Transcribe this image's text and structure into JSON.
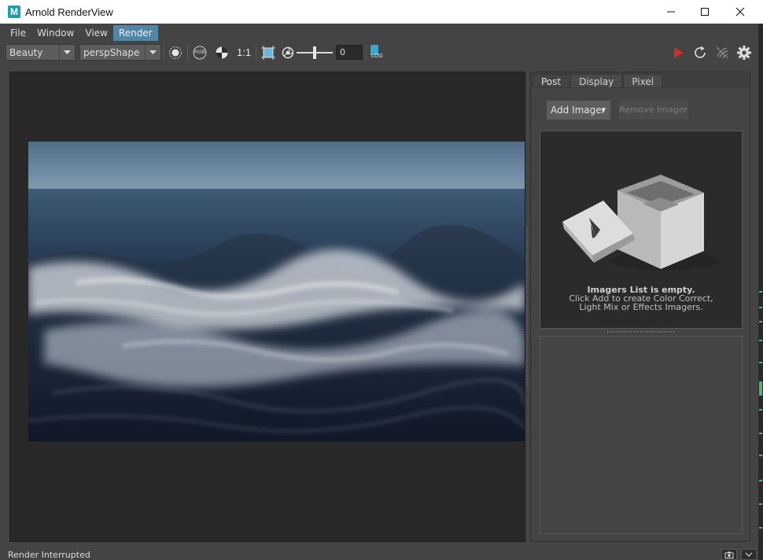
{
  "window": {
    "app_logo": "M",
    "title": "Arnold RenderView"
  },
  "menubar": {
    "items": [
      "File",
      "Window",
      "View",
      "Render"
    ],
    "active": "Render"
  },
  "toolbar": {
    "aov_value": "Beauty",
    "camera_value": "perspShape",
    "rgb_label": "RGB",
    "ratio_label": "1:1",
    "exposure_value": "0",
    "log_label": "LOG",
    "icons": {
      "crop": "crop-region-icon",
      "channel": "channel-icon",
      "rgb": "rgb-icon",
      "background": "checker-background-icon",
      "frame": "frame-region-icon",
      "exposure": "aperture-icon",
      "log": "log-icon",
      "render": "render-play-icon",
      "refresh": "refresh-icon",
      "interactive": "interactive-render-icon",
      "settings": "gear-icon"
    },
    "render_accent": "#d42a2a"
  },
  "side_panel": {
    "tabs": [
      "Post",
      "Display",
      "Pixel"
    ],
    "active_tab": "Post",
    "add_imager_label": "Add Imager",
    "remove_imager_label": "Remove Imager",
    "empty_title": "Imagers List is empty.",
    "empty_line1": "Click Add to create Color Correct,",
    "empty_line2": "Light Mix or Effects Imagers."
  },
  "statusbar": {
    "text": "Render Interrupted"
  },
  "colors": {
    "accent": "#5285a6",
    "background": "#444444",
    "viewport": "#282828"
  }
}
